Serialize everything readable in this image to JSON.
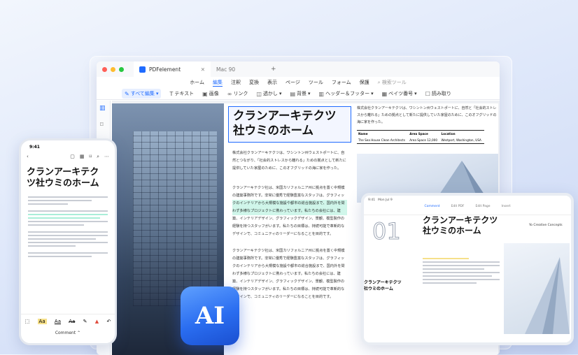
{
  "desktop": {
    "tab_title": "PDFelement",
    "tab2": "Mac 90",
    "plus": "+",
    "menu": [
      "ホーム",
      "編集",
      "注釈",
      "変換",
      "表示",
      "ページ",
      "ツール",
      "フォーム",
      "保護"
    ],
    "search": "検索ツール",
    "toolbar": [
      "すべて編集",
      "テキスト",
      "画像",
      "リンク",
      "透かし",
      "背景",
      "ヘッダー＆フッター",
      "ベイツ番号",
      "読み取り"
    ],
    "heading_line1": "クランアーキテクツ",
    "heading_line2": "社ウミのホーム",
    "para1": "株式会社クランアーキテクツは、ワシントン州ウェストポートに、自然とつながり、「社会的ストレスから離れる」ための拠点として新たに提供していた家屋のために、このオフグリッドの海に家を作った。",
    "para2": "クランアーキテクツ社は、米国カリフォルニア州に拠点を置く中規模の建築事務所です。非常に優秀で経験豊富なスタッフは、グラフィックのインテリアから大規模な施設や都市の総合施設まで、国内外を問わず多様なプロジェクトに携わっています。私たちの会社には、建築、インテリアデザイン、グラフィックデザイン、景観、模型製作の経験を持つスタッフがいます。私たちの目標は、持続可能で革新的なデザインで、コミュニティのリーダーになることを目的です。",
    "para3": "クランアーキテクツ社は、米国カリフォルニア州に拠点を置く中規模の建築事務所です。非常に優秀で経験豊富なスタッフは、グラフィックのインテリアから大規模な施設や都市の総合施設まで、国内外を問わず多様なプロジェクトに携わっています。私たちの会社には、建築、インテリアデザイン、グラフィックデザイン、景観、模型製作の経験を持つスタッフがいます。私たちの目標は、持続可能で革新的なデザインで、コミュニティのリーダーになることを目的です。",
    "right_para": "株式会社クランアーキテクツは、ワシントン州ウェストポートに、自然と「社会的ストレスから離れる」ための拠点として新たに提供していた家屋のために、このオフグリッドの海に家を作った。",
    "table_headers": [
      "Name",
      "Area Space",
      "Location"
    ],
    "table_values": [
      "The Sea House Clean Architects",
      "Area Space 12,000",
      "Westport, Washington, USA"
    ]
  },
  "phone": {
    "time": "9:41",
    "title1": "クランアーキテク",
    "title2": "ツ社ウミのホーム",
    "footer_label": "Comment"
  },
  "tablet": {
    "time": "9:41",
    "date": "Mon Jul 9",
    "tabs": [
      "Comment",
      "Edit PDF",
      "Edit Page",
      "Insert"
    ],
    "heading1": "クランアーキテクツ",
    "heading2": "社ウミのホーム",
    "number": "01",
    "subheading1": "クランアーキテクツ",
    "subheading2": "社ウミのホーム",
    "right_label": "Yo Creative Concepts"
  },
  "ai_badge": "AI",
  "colors": {
    "accent": "#1f6bff",
    "highlight": "#a9eed8",
    "ai_bg": "#2a6df0"
  }
}
